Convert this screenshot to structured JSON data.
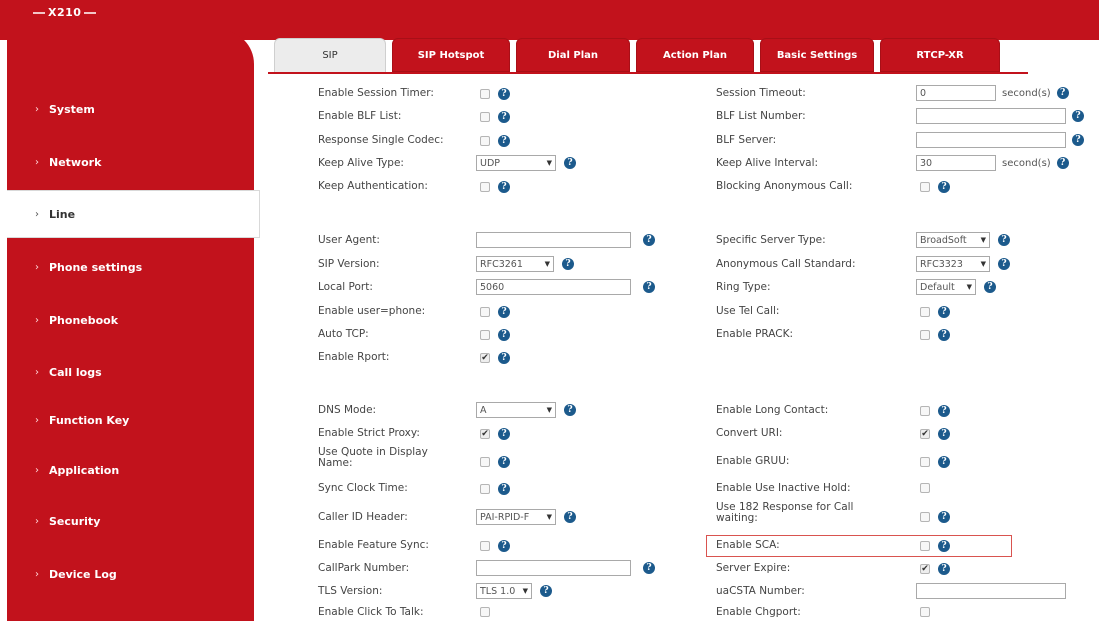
{
  "app": {
    "logo": "X210"
  },
  "sidebar": {
    "items": [
      {
        "label": "System"
      },
      {
        "label": "Network"
      },
      {
        "label": "Line"
      },
      {
        "label": "Phone settings"
      },
      {
        "label": "Phonebook"
      },
      {
        "label": "Call logs"
      },
      {
        "label": "Function Key"
      },
      {
        "label": "Application"
      },
      {
        "label": "Security"
      },
      {
        "label": "Device Log"
      }
    ],
    "active_index": 2
  },
  "tabs": [
    {
      "label": "SIP"
    },
    {
      "label": "SIP Hotspot"
    },
    {
      "label": "Dial Plan"
    },
    {
      "label": "Action Plan"
    },
    {
      "label": "Basic Settings"
    },
    {
      "label": "RTCP-XR"
    }
  ],
  "colors": {
    "brand_red": "#c2121c",
    "help_blue": "#1c5a8c",
    "highlight": "#d9534f"
  },
  "left": {
    "enable_session_timer": {
      "label": "Enable Session Timer:",
      "checked": false
    },
    "enable_blf_list": {
      "label": "Enable BLF List:",
      "checked": false
    },
    "response_single_codec": {
      "label": "Response Single Codec:",
      "checked": false
    },
    "keep_alive_type": {
      "label": "Keep Alive Type:",
      "value": "UDP"
    },
    "keep_authentication": {
      "label": "Keep Authentication:",
      "checked": false
    },
    "user_agent": {
      "label": "User Agent:",
      "value": ""
    },
    "sip_version": {
      "label": "SIP Version:",
      "value": "RFC3261"
    },
    "local_port": {
      "label": "Local Port:",
      "value": "5060"
    },
    "enable_user_phone": {
      "label": "Enable user=phone:",
      "checked": false
    },
    "auto_tcp": {
      "label": "Auto TCP:",
      "checked": false
    },
    "enable_rport": {
      "label": "Enable Rport:",
      "checked": true
    },
    "dns_mode": {
      "label": "DNS Mode:",
      "value": "A"
    },
    "enable_strict_proxy": {
      "label": "Enable Strict Proxy:",
      "checked": true
    },
    "use_quote": {
      "label": "Use Quote in Display Name:",
      "checked": false
    },
    "sync_clock_time": {
      "label": "Sync Clock Time:",
      "checked": false
    },
    "caller_id_header": {
      "label": "Caller ID Header:",
      "value": "PAI-RPID-F"
    },
    "enable_feature_sync": {
      "label": "Enable Feature Sync:",
      "checked": false
    },
    "callpark_number": {
      "label": "CallPark Number:",
      "value": ""
    },
    "tls_version": {
      "label": "TLS Version:",
      "value": "TLS 1.0"
    },
    "enable_click_to_talk": {
      "label": "Enable Click To Talk:",
      "checked": false
    }
  },
  "right": {
    "session_timeout": {
      "label": "Session Timeout:",
      "value": "0",
      "unit": "second(s)"
    },
    "blf_list_number": {
      "label": "BLF List Number:",
      "value": ""
    },
    "blf_server": {
      "label": "BLF Server:",
      "value": ""
    },
    "keep_alive_interval": {
      "label": "Keep Alive Interval:",
      "value": "30",
      "unit": "second(s)"
    },
    "blocking_anonymous_call": {
      "label": "Blocking Anonymous Call:",
      "checked": false
    },
    "specific_server_type": {
      "label": "Specific Server Type:",
      "value": "BroadSoft"
    },
    "anonymous_call_standard": {
      "label": "Anonymous Call Standard:",
      "value": "RFC3323"
    },
    "ring_type": {
      "label": "Ring Type:",
      "value": "Default"
    },
    "use_tel_call": {
      "label": "Use Tel Call:",
      "checked": false
    },
    "enable_prack": {
      "label": "Enable PRACK:",
      "checked": false
    },
    "enable_long_contact": {
      "label": "Enable Long Contact:",
      "checked": false
    },
    "convert_uri": {
      "label": "Convert URI:",
      "checked": true
    },
    "enable_gruu": {
      "label": "Enable GRUU:",
      "checked": false
    },
    "enable_use_inactive_hold": {
      "label": "Enable Use Inactive Hold:",
      "checked": false
    },
    "use_182": {
      "label": "Use 182 Response for Call waiting:",
      "checked": false
    },
    "enable_sca": {
      "label": "Enable SCA:",
      "checked": false
    },
    "server_expire": {
      "label": "Server Expire:",
      "checked": true
    },
    "uacsta_number": {
      "label": "uaCSTA Number:",
      "value": ""
    },
    "enable_chgport": {
      "label": "Enable Chgport:",
      "checked": false
    }
  }
}
